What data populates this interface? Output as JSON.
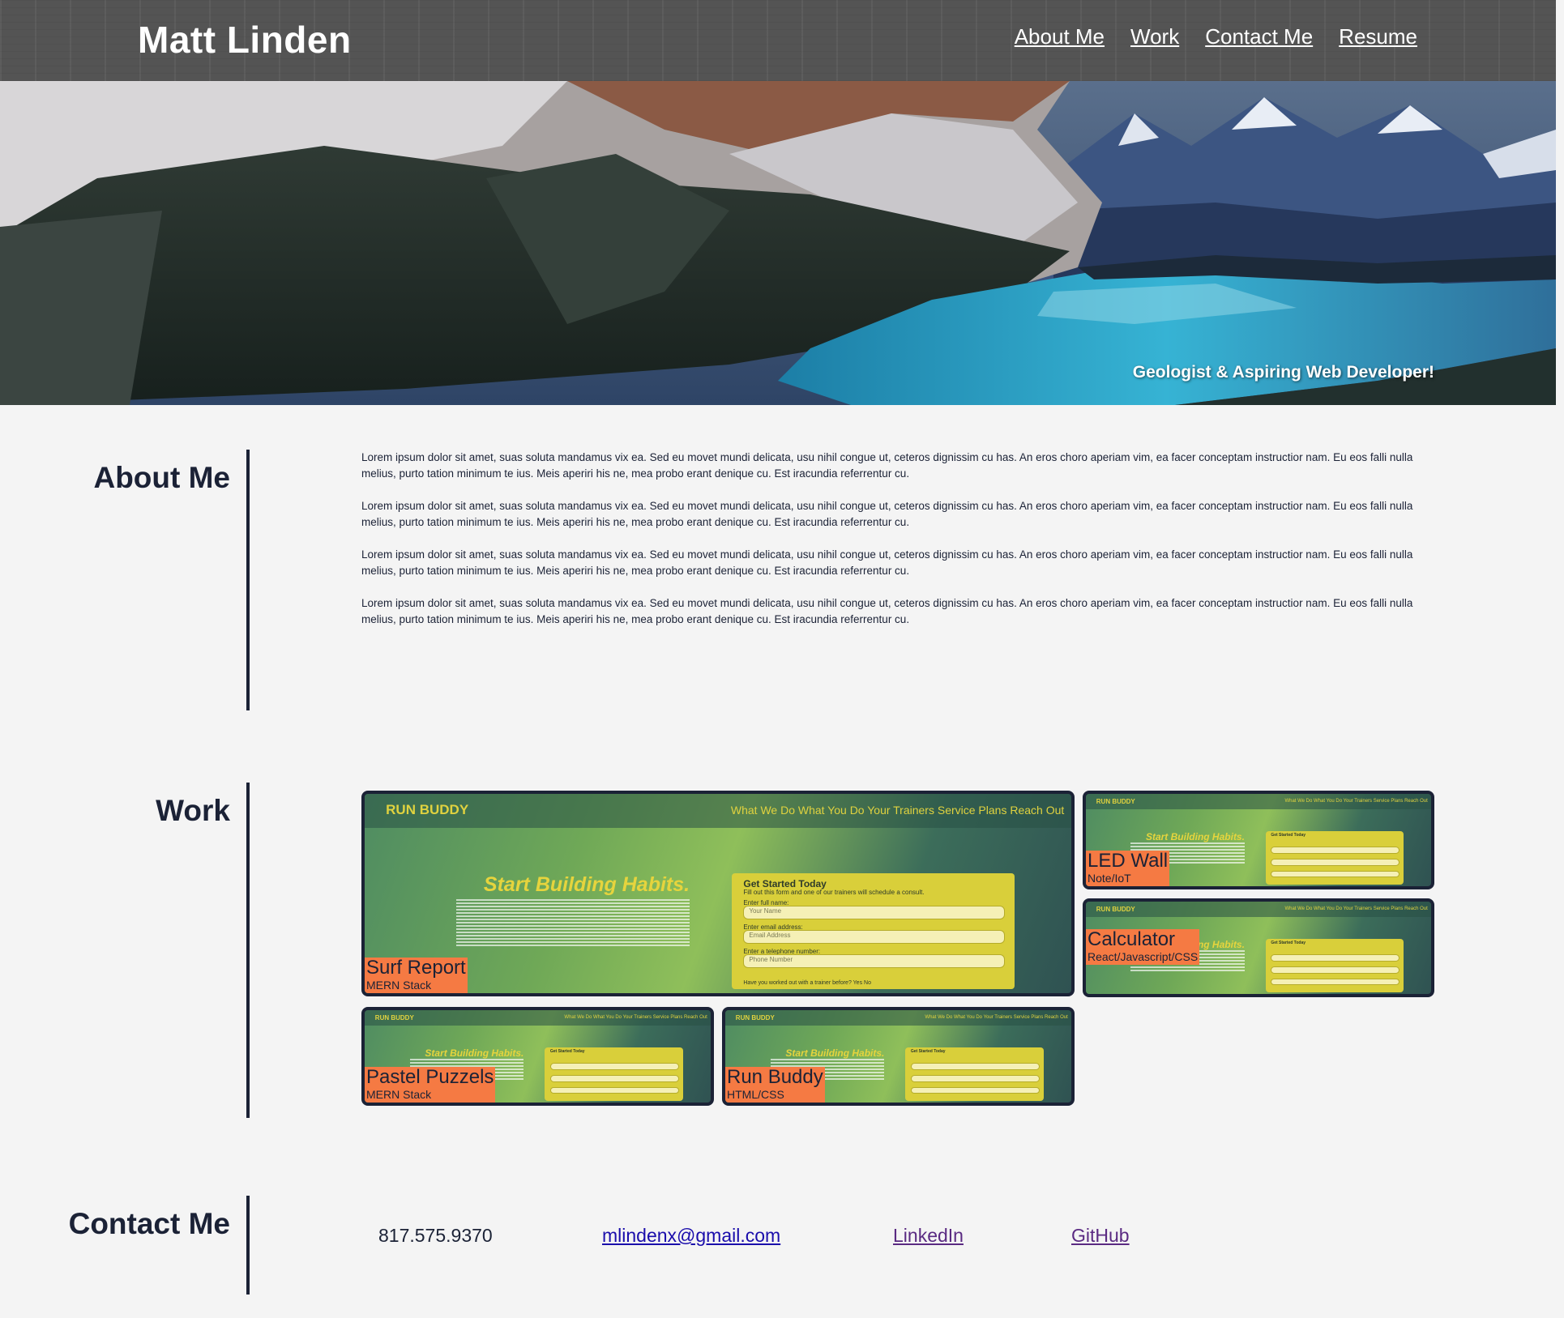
{
  "header": {
    "name": "Matt Linden",
    "nav": [
      "About Me",
      "Work",
      "Contact Me",
      "Resume"
    ]
  },
  "hero": {
    "tagline": "Geologist & Aspiring Web Developer!"
  },
  "about": {
    "title": "About Me",
    "paragraphs": [
      "Lorem ipsum dolor sit amet, suas soluta mandamus vix ea. Sed eu movet mundi delicata, usu nihil congue ut, ceteros dignissim cu has. An eros choro aperiam vim, ea facer conceptam instructior nam. Eu eos falli nulla melius, purto tation minimum te ius. Meis aperiri his ne, mea probo erant denique cu. Est iracundia referrentur cu.",
      "Lorem ipsum dolor sit amet, suas soluta mandamus vix ea. Sed eu movet mundi delicata, usu nihil congue ut, ceteros dignissim cu has. An eros choro aperiam vim, ea facer conceptam instructior nam. Eu eos falli nulla melius, purto tation minimum te ius. Meis aperiri his ne, mea probo erant denique cu. Est iracundia referrentur cu.",
      "Lorem ipsum dolor sit amet, suas soluta mandamus vix ea. Sed eu movet mundi delicata, usu nihil congue ut, ceteros dignissim cu has. An eros choro aperiam vim, ea facer conceptam instructior nam. Eu eos falli nulla melius, purto tation minimum te ius. Meis aperiri his ne, mea probo erant denique cu. Est iracundia referrentur cu.",
      "Lorem ipsum dolor sit amet, suas soluta mandamus vix ea. Sed eu movet mundi delicata, usu nihil congue ut, ceteros dignissim cu has. An eros choro aperiam vim, ea facer conceptam instructior nam. Eu eos falli nulla melius, purto tation minimum te ius. Meis aperiri his ne, mea probo erant denique cu. Est iracundia referrentur cu."
    ]
  },
  "work": {
    "title": "Work",
    "thumbnail": {
      "brand": "RUN BUDDY",
      "menu": "What We Do   What You Do   Your Trainers   Service Plans   Reach Out",
      "headline": "Start Building Habits.",
      "form_title": "Get Started Today",
      "form_sub": "Fill out this form and one of our trainers will schedule a consult.",
      "labels": [
        "Enter full name:",
        "Enter email address:",
        "Enter a telephone number:"
      ],
      "placeholders": [
        "Your Name",
        "Email Address",
        "Phone Number"
      ],
      "question": "Have you worked out with a trainer before?   Yes   No"
    },
    "projects": [
      {
        "title": "Surf Report",
        "tech": "MERN Stack"
      },
      {
        "title": "LED Wall",
        "tech": "Note/IoT"
      },
      {
        "title": "Calculator",
        "tech": "React/Javascript/CSS"
      },
      {
        "title": "Pastel Puzzels",
        "tech": "MERN Stack"
      },
      {
        "title": "Run Buddy",
        "tech": "HTML/CSS"
      }
    ]
  },
  "contact": {
    "title": "Contact Me",
    "phone": "817.575.9370",
    "email": "mlindenx@gmail.com",
    "linkedin": "LinkedIn",
    "github": "GitHub"
  },
  "colors": {
    "navy": "#1b2236",
    "label_orange": "#f57a43",
    "page_bg": "#f4f4f4",
    "header_bg": "#545454"
  }
}
